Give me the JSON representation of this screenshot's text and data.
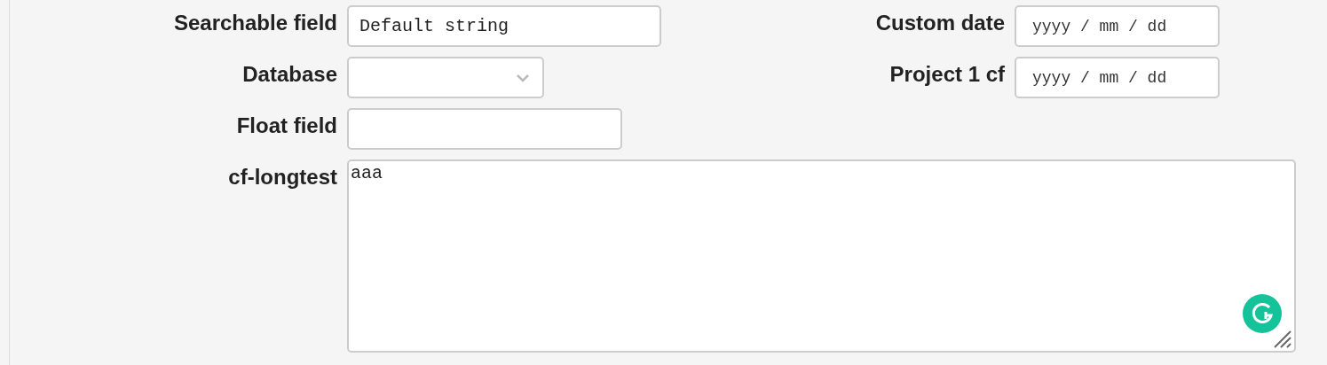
{
  "fields": [
    {
      "kind": "text",
      "label": "Searchable field",
      "value": "Default string"
    },
    {
      "kind": "select",
      "label": "Database"
    },
    {
      "kind": "text",
      "label": "Float field"
    },
    {
      "kind": "textarea",
      "label": "cf-longtest",
      "value": "aaa"
    }
  ],
  "side_fields": [
    {
      "kind": "date",
      "label": "Custom date",
      "placeholder": "yyyy / mm / dd"
    },
    {
      "kind": "date",
      "label": "Project 1 cf",
      "placeholder": "yyyy / mm / dd"
    }
  ]
}
